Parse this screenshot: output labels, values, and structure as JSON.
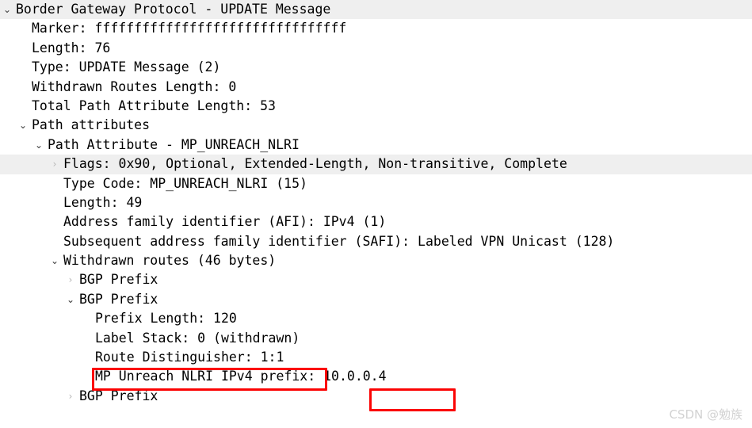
{
  "window": {
    "title": "Border Gateway Protocol - UPDATE Message",
    "app": "packet-detail-tree"
  },
  "colors": {
    "background": "#ffffff",
    "text": "#000000",
    "row_highlight": "#efefef",
    "annotation_red": "#fb0404",
    "arrow_open": "#3a3a3a",
    "arrow_closed": "#b6b6b6",
    "watermark": "#d2d2d2"
  },
  "icons": {
    "chevron_down": "⌄",
    "chevron_right": "›"
  },
  "tree": {
    "rows": [
      {
        "id": "bgp-update-message",
        "label": "Border Gateway Protocol - UPDATE Message",
        "level": 0,
        "toggle": "open",
        "highlight": true
      },
      {
        "id": "marker",
        "label": "Marker: ffffffffffffffffffffffffffffffff",
        "level": 1,
        "toggle": "none",
        "highlight": false
      },
      {
        "id": "length",
        "label": "Length: 76",
        "level": 1,
        "toggle": "none",
        "highlight": false
      },
      {
        "id": "type",
        "label": "Type: UPDATE Message (2)",
        "level": 1,
        "toggle": "none",
        "highlight": false
      },
      {
        "id": "withdrawn-routes-length",
        "label": "Withdrawn Routes Length: 0",
        "level": 1,
        "toggle": "none",
        "highlight": false
      },
      {
        "id": "total-path-attribute-length",
        "label": "Total Path Attribute Length: 53",
        "level": 1,
        "toggle": "none",
        "highlight": false
      },
      {
        "id": "path-attributes",
        "label": "Path attributes",
        "level": 1,
        "toggle": "open",
        "highlight": false
      },
      {
        "id": "path-attribute-mp-unreach-nlri",
        "label": "Path Attribute - MP_UNREACH_NLRI",
        "level": 2,
        "toggle": "open",
        "highlight": false
      },
      {
        "id": "flags",
        "label": "Flags: 0x90, Optional, Extended-Length, Non-transitive, Complete",
        "level": 3,
        "toggle": "closed",
        "highlight": true
      },
      {
        "id": "type-code",
        "label": "Type Code: MP_UNREACH_NLRI (15)",
        "level": 3,
        "toggle": "none",
        "highlight": false
      },
      {
        "id": "attr-length",
        "label": "Length: 49",
        "level": 3,
        "toggle": "none",
        "highlight": false
      },
      {
        "id": "afi",
        "label": "Address family identifier (AFI): IPv4 (1)",
        "level": 3,
        "toggle": "none",
        "highlight": false
      },
      {
        "id": "safi",
        "label": "Subsequent address family identifier (SAFI): Labeled VPN Unicast (128)",
        "level": 3,
        "toggle": "none",
        "highlight": false
      },
      {
        "id": "withdrawn-routes",
        "label": "Withdrawn routes (46 bytes)",
        "level": 3,
        "toggle": "open",
        "highlight": false
      },
      {
        "id": "bgp-prefix-1",
        "label": "BGP Prefix",
        "level": 4,
        "toggle": "closed",
        "highlight": false
      },
      {
        "id": "bgp-prefix-2",
        "label": "BGP Prefix",
        "level": 4,
        "toggle": "open",
        "highlight": false
      },
      {
        "id": "prefix-length",
        "label": "Prefix Length: 120",
        "level": 5,
        "toggle": "none",
        "highlight": false
      },
      {
        "id": "label-stack",
        "label": "Label Stack: 0 (withdrawn)",
        "level": 5,
        "toggle": "none",
        "highlight": false
      },
      {
        "id": "route-distinguisher",
        "label": "Route Distinguisher: 1:1",
        "level": 5,
        "toggle": "none",
        "highlight": false
      },
      {
        "id": "mp-unreach-nlri-ipv4-prefix",
        "label": "MP Unreach NLRI IPv4 prefix: 10.0.0.4",
        "level": 5,
        "toggle": "none",
        "highlight": false
      },
      {
        "id": "bgp-prefix-3",
        "label": "BGP Prefix",
        "level": 4,
        "toggle": "closed",
        "highlight": false
      }
    ]
  },
  "annotations": [
    {
      "id": "route-distinguisher-highlight",
      "target_text": "Route Distinguisher: 1:1",
      "color": "#fb0404"
    },
    {
      "id": "ipv4-prefix-highlight",
      "target_text": "10.0.0.4",
      "color": "#fb0404"
    }
  ],
  "watermark": {
    "text": "CSDN @勉族"
  }
}
